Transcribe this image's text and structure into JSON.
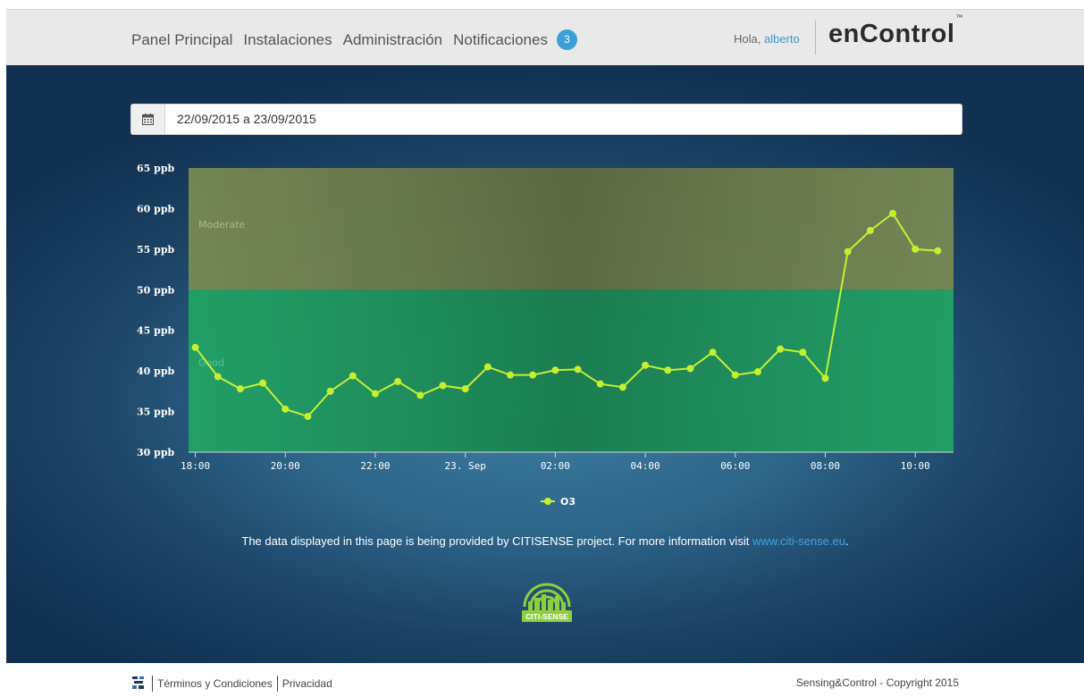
{
  "nav": {
    "items": [
      "Panel Principal",
      "Instalaciones",
      "Administración",
      "Notificaciones"
    ],
    "notification_count": "3"
  },
  "header": {
    "greeting": "Hola,",
    "username": "alberto",
    "logo": "enControl",
    "logo_tm": "™"
  },
  "date_range": {
    "value": "22/09/2015 a 23/09/2015",
    "icon": "calendar-icon"
  },
  "chart_data": {
    "type": "line",
    "ylim": [
      30,
      65
    ],
    "y_ticks": [
      30,
      35,
      40,
      45,
      50,
      55,
      60,
      65
    ],
    "y_tick_labels": [
      "30 ppb",
      "35 ppb",
      "40 ppb",
      "45 ppb",
      "50 ppb",
      "55 ppb",
      "60 ppb",
      "65 ppb"
    ],
    "x_tick_labels": [
      "18:00",
      "20:00",
      "22:00",
      "23. Sep",
      "02:00",
      "04:00",
      "06:00",
      "08:00",
      "10:00"
    ],
    "x_tick_hours": [
      18,
      20,
      22,
      24,
      26,
      28,
      30,
      32,
      34
    ],
    "xlim_hours": [
      17.85,
      34.85
    ],
    "bands": [
      {
        "label": "Good",
        "from": 30,
        "to": 50,
        "color": "#22a565"
      },
      {
        "label": "Moderate",
        "from": 50,
        "to": 65,
        "color": "#7d8c55"
      }
    ],
    "series": [
      {
        "name": "O3",
        "color": "#c5f030",
        "x_hours": [
          18,
          18.5,
          19,
          19.5,
          20,
          20.5,
          21,
          21.5,
          22,
          22.5,
          23,
          23.5,
          24,
          24.5,
          25,
          25.5,
          26,
          26.5,
          27,
          27.5,
          28,
          28.5,
          29,
          29.5,
          30,
          30.5,
          31,
          31.5,
          32,
          32.5,
          33,
          33.5,
          34,
          34.5
        ],
        "values": [
          42.9,
          39.3,
          37.8,
          38.5,
          35.3,
          34.4,
          37.5,
          39.4,
          37.2,
          38.7,
          37.0,
          38.2,
          37.8,
          40.5,
          39.5,
          39.5,
          40.1,
          40.2,
          38.4,
          38.0,
          40.7,
          40.1,
          40.3,
          42.3,
          39.5,
          39.9,
          42.7,
          42.3,
          39.1,
          54.7,
          57.3,
          59.4,
          55.0,
          54.8
        ]
      }
    ],
    "legend": "bottom-center"
  },
  "footer": {
    "text_before_link": "The data displayed in this page is being provided by CITISENSE project. For more information visit ",
    "link_text": "www.citi-sense.eu",
    "text_after_link": ".",
    "citi_logo_text": "CITI-SENSE",
    "terms": "Términos y Condiciones",
    "privacy": "Privacidad",
    "copyright": "Sensing&Control - Copyright 2015"
  },
  "colors": {
    "accent": "#3aa0d8",
    "header_bg": "#e9e9e9",
    "main_bg": "#1b4264",
    "link": "#3fa3e5"
  }
}
